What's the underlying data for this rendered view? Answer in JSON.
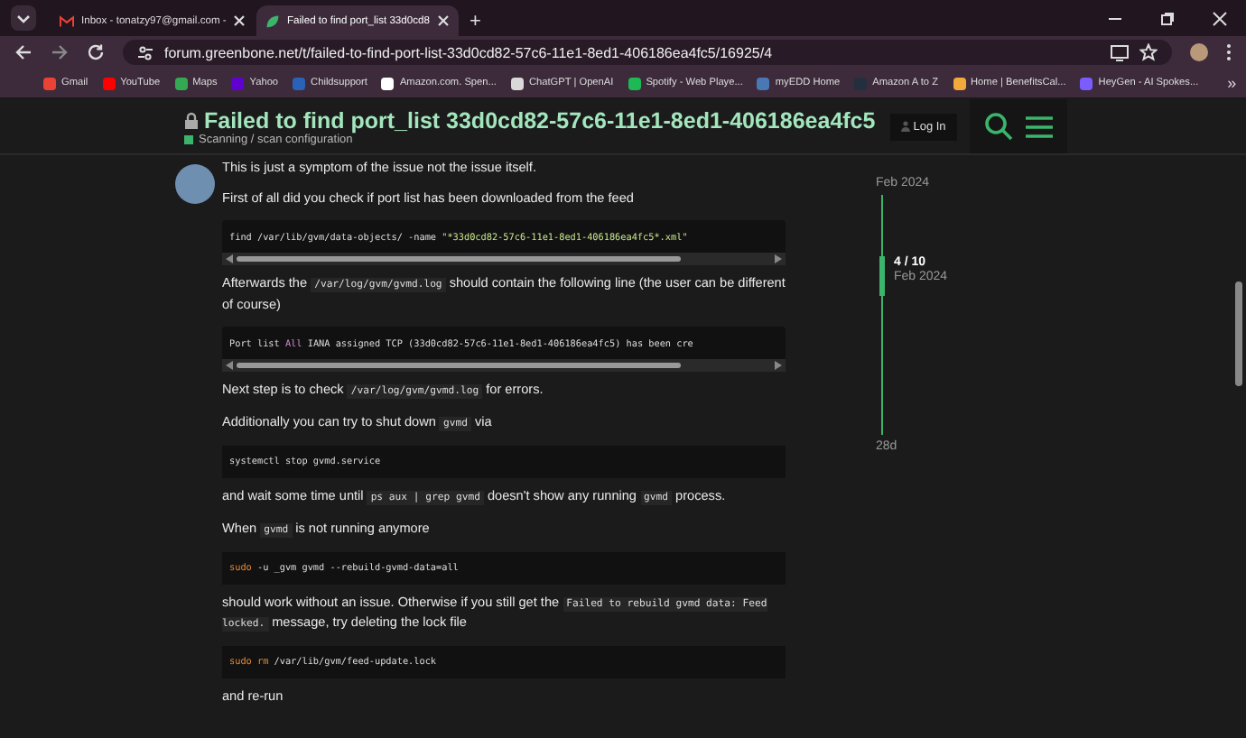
{
  "browser": {
    "tabs": [
      {
        "title": "Inbox - tonatzy97@gmail.com -",
        "selected": false
      },
      {
        "title": "Failed to find port_list 33d0cd8",
        "selected": true
      }
    ],
    "new_tab": "+",
    "url": "forum.greenbone.net/t/failed-to-find-port-list-33d0cd82-57c6-11e1-8ed1-406186ea4fc5/16925/4",
    "bookmarks": [
      {
        "label": "Gmail",
        "color": "#ea4335"
      },
      {
        "label": "YouTube",
        "color": "#ff0000"
      },
      {
        "label": "Maps",
        "color": "#34a853"
      },
      {
        "label": "Yahoo",
        "color": "#6001d2"
      },
      {
        "label": "Childsupport",
        "color": "#2a62b8"
      },
      {
        "label": "Amazon.com. Spen...",
        "color": "#ffffff"
      },
      {
        "label": "ChatGPT | OpenAI",
        "color": "#d9d9d9"
      },
      {
        "label": "Spotify - Web Playe...",
        "color": "#1db954"
      },
      {
        "label": "myEDD Home",
        "color": "#4a78b5"
      },
      {
        "label": "Amazon A to Z",
        "color": "#232f3e"
      },
      {
        "label": "Home | BenefitsCal...",
        "color": "#f2a93b"
      },
      {
        "label": "HeyGen - AI Spokes...",
        "color": "#7b5cff"
      }
    ],
    "more": "»"
  },
  "header": {
    "title": "Failed to find port_list 33d0cd82-57c6-11e1-8ed1-406186ea4fc5",
    "category": "Scanning / scan configuration",
    "login": "Log In"
  },
  "post": [
    {
      "kind": "paragraph",
      "parts": [
        {
          "kind": "text",
          "text": "This is just a symptom of the issue not the issue itself."
        }
      ]
    },
    {
      "kind": "paragraph",
      "parts": [
        {
          "kind": "text",
          "text": "First of all did you check if port list has been downloaded from the feed"
        }
      ]
    },
    {
      "kind": "code",
      "scrollable": true,
      "parts": [
        {
          "kind": "plain",
          "text": "find /var/lib/gvm/data-objects/ -name "
        },
        {
          "kind": "string",
          "text": "\"*33d0cd82-57c6-11e1-8ed1-406186ea4fc5*.xml\""
        }
      ]
    },
    {
      "kind": "paragraph",
      "parts": [
        {
          "kind": "text",
          "text": "Afterwards the "
        },
        {
          "kind": "code",
          "text": "/var/log/gvm/gvmd.log"
        },
        {
          "kind": "text",
          "text": " should contain the following line (the user can be different of course)"
        }
      ]
    },
    {
      "kind": "code",
      "scrollable": true,
      "parts": [
        {
          "kind": "plain",
          "text": "Port list "
        },
        {
          "kind": "keyword",
          "text": "All"
        },
        {
          "kind": "plain",
          "text": " IANA assigned TCP (33d0cd82-57c6-11e1-8ed1-406186ea4fc5) has been cre"
        }
      ]
    },
    {
      "kind": "paragraph",
      "parts": [
        {
          "kind": "text",
          "text": "Next step is to check "
        },
        {
          "kind": "code",
          "text": "/var/log/gvm/gvmd.log"
        },
        {
          "kind": "text",
          "text": " for errors."
        }
      ]
    },
    {
      "kind": "paragraph",
      "parts": [
        {
          "kind": "text",
          "text": "Additionally you can try to shut down "
        },
        {
          "kind": "code",
          "text": "gvmd"
        },
        {
          "kind": "text",
          "text": " via"
        }
      ]
    },
    {
      "kind": "code",
      "scrollable": false,
      "parts": [
        {
          "kind": "plain",
          "text": "systemctl stop gvmd.service"
        }
      ]
    },
    {
      "kind": "paragraph",
      "parts": [
        {
          "kind": "text",
          "text": "and wait some time until "
        },
        {
          "kind": "code",
          "text": "ps aux | grep gvmd"
        },
        {
          "kind": "text",
          "text": " doesn't show any running "
        },
        {
          "kind": "code",
          "text": "gvmd"
        },
        {
          "kind": "text",
          "text": " process."
        }
      ]
    },
    {
      "kind": "paragraph",
      "parts": [
        {
          "kind": "text",
          "text": "When "
        },
        {
          "kind": "code",
          "text": "gvmd"
        },
        {
          "kind": "text",
          "text": " is not running anymore"
        }
      ]
    },
    {
      "kind": "code",
      "scrollable": false,
      "parts": [
        {
          "kind": "command",
          "text": "sudo"
        },
        {
          "kind": "plain",
          "text": " -u _gvm gvmd --rebuild-gvmd-data=all"
        }
      ]
    },
    {
      "kind": "paragraph",
      "parts": [
        {
          "kind": "text",
          "text": "should work without an issue. Otherwise if you still get the "
        },
        {
          "kind": "code",
          "text": "Failed to rebuild gvmd data: Feed locked."
        },
        {
          "kind": "text",
          "text": " message, try deleting the lock file"
        }
      ]
    },
    {
      "kind": "code",
      "scrollable": false,
      "parts": [
        {
          "kind": "command",
          "text": "sudo rm"
        },
        {
          "kind": "plain",
          "text": " /var/lib/gvm/feed-update.lock"
        }
      ]
    },
    {
      "kind": "paragraph",
      "parts": [
        {
          "kind": "text",
          "text": "and re-run"
        }
      ]
    }
  ],
  "timeline": {
    "start": "Feb 2024",
    "position": "4 / 10",
    "position_date": "Feb 2024",
    "end": "28d"
  }
}
